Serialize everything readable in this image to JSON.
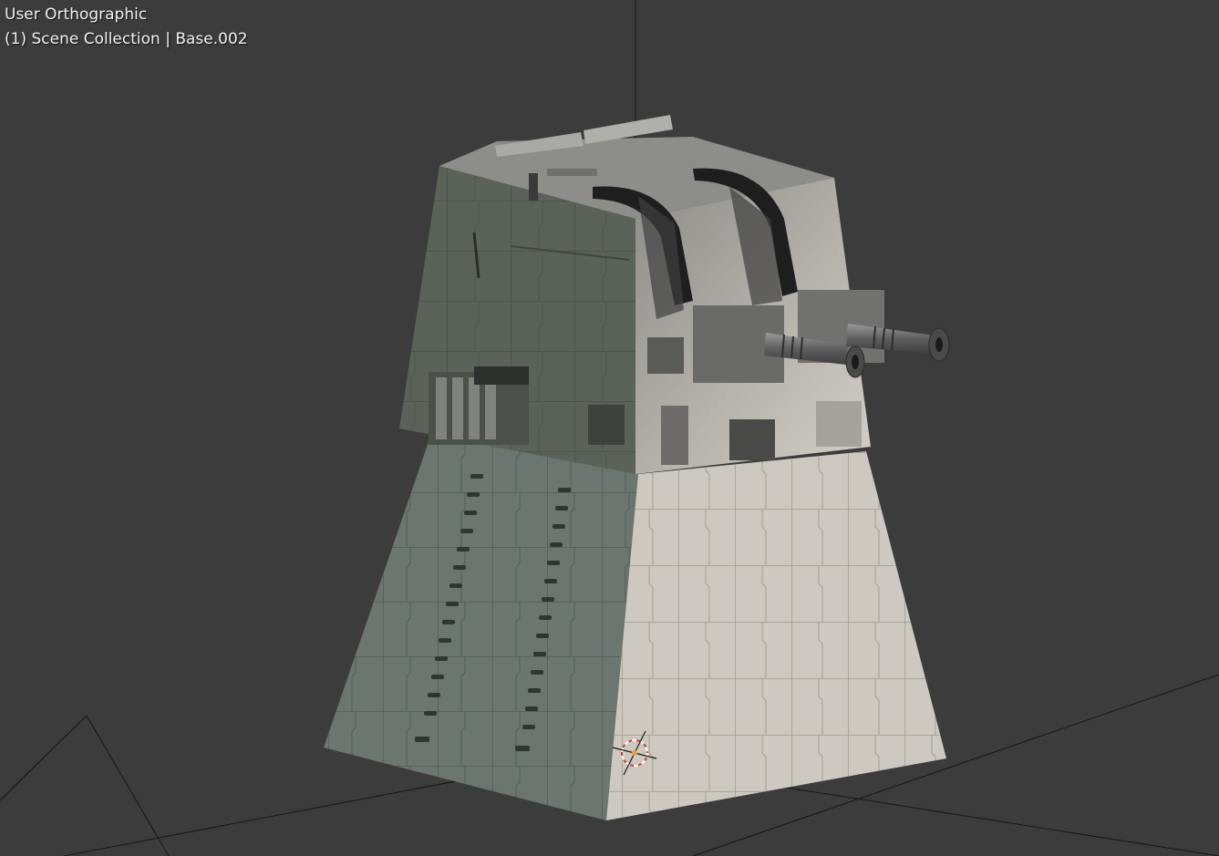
{
  "viewport": {
    "view_name": "User Orthographic",
    "collection_info": "(1) Scene Collection | Base.002",
    "background_color": "#3c3c3c",
    "object_name": "Base.002"
  },
  "icons": {
    "origin": "3d-cursor-icon"
  }
}
